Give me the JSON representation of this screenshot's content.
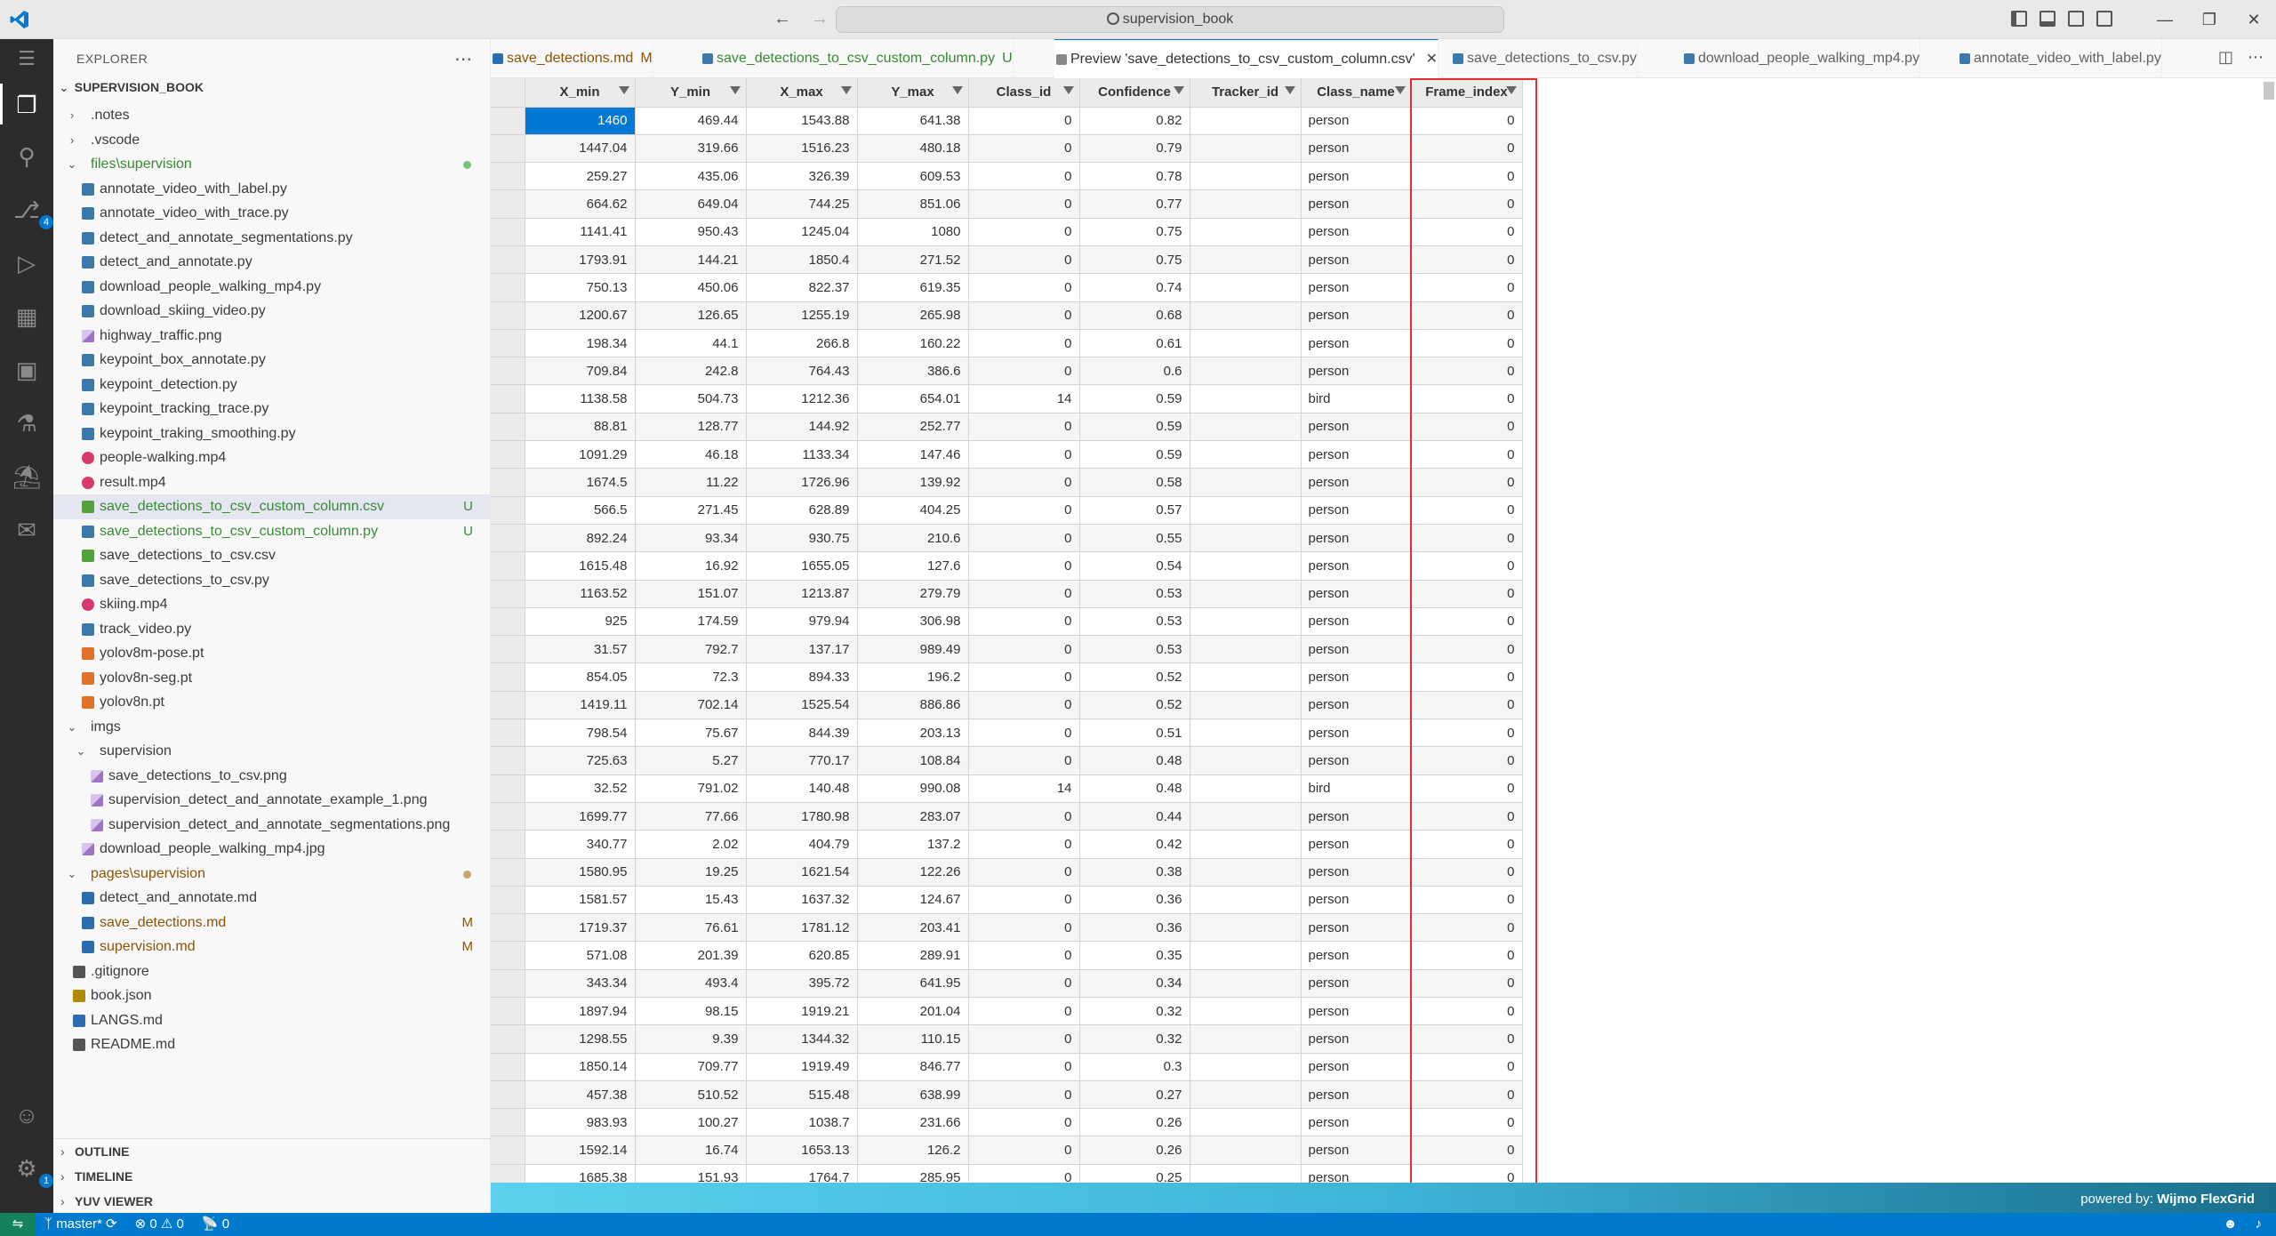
{
  "title": {
    "search_text": "supervision_book"
  },
  "activity": {
    "scm_badge": "4",
    "account_badge": "1"
  },
  "explorer": {
    "title": "EXPLORER",
    "root": "SUPERVISION_BOOK",
    "items": [
      {
        "label": ".notes",
        "kind": "folder",
        "depth": 1,
        "open": false
      },
      {
        "label": ".vscode",
        "kind": "folder",
        "depth": 1,
        "open": false
      },
      {
        "label": "files\\supervision",
        "kind": "folder",
        "depth": 1,
        "open": true,
        "color": "green",
        "dot": "#7bc27b"
      },
      {
        "label": "annotate_video_with_label.py",
        "kind": "py",
        "depth": 2
      },
      {
        "label": "annotate_video_with_trace.py",
        "kind": "py",
        "depth": 2
      },
      {
        "label": "detect_and_annotate_segmentations.py",
        "kind": "py",
        "depth": 2
      },
      {
        "label": "detect_and_annotate.py",
        "kind": "py",
        "depth": 2
      },
      {
        "label": "download_people_walking_mp4.py",
        "kind": "py",
        "depth": 2
      },
      {
        "label": "download_skiing_video.py",
        "kind": "py",
        "depth": 2
      },
      {
        "label": "highway_traffic.png",
        "kind": "img",
        "depth": 2
      },
      {
        "label": "keypoint_box_annotate.py",
        "kind": "py",
        "depth": 2
      },
      {
        "label": "keypoint_detection.py",
        "kind": "py",
        "depth": 2
      },
      {
        "label": "keypoint_tracking_trace.py",
        "kind": "py",
        "depth": 2
      },
      {
        "label": "keypoint_traking_smoothing.py",
        "kind": "py",
        "depth": 2
      },
      {
        "label": "people-walking.mp4",
        "kind": "vid",
        "depth": 2
      },
      {
        "label": "result.mp4",
        "kind": "vid",
        "depth": 2
      },
      {
        "label": "save_detections_to_csv_custom_column.csv",
        "kind": "csv",
        "depth": 2,
        "color": "green",
        "status": "U",
        "selected": true
      },
      {
        "label": "save_detections_to_csv_custom_column.py",
        "kind": "py",
        "depth": 2,
        "color": "green",
        "status": "U"
      },
      {
        "label": "save_detections_to_csv.csv",
        "kind": "csv",
        "depth": 2
      },
      {
        "label": "save_detections_to_csv.py",
        "kind": "py",
        "depth": 2
      },
      {
        "label": "skiing.mp4",
        "kind": "vid",
        "depth": 2
      },
      {
        "label": "track_video.py",
        "kind": "py",
        "depth": 2
      },
      {
        "label": "yolov8m-pose.pt",
        "kind": "rss",
        "depth": 2
      },
      {
        "label": "yolov8n-seg.pt",
        "kind": "rss",
        "depth": 2
      },
      {
        "label": "yolov8n.pt",
        "kind": "rss",
        "depth": 2
      },
      {
        "label": "imgs",
        "kind": "folder",
        "depth": 1,
        "open": true
      },
      {
        "label": "supervision",
        "kind": "folder",
        "depth": 2,
        "open": true
      },
      {
        "label": "save_detections_to_csv.png",
        "kind": "img",
        "depth": 3
      },
      {
        "label": "supervision_detect_and_annotate_example_1.png",
        "kind": "img",
        "depth": 3
      },
      {
        "label": "supervision_detect_and_annotate_segmentations.png",
        "kind": "img",
        "depth": 3
      },
      {
        "label": "download_people_walking_mp4.jpg",
        "kind": "img",
        "depth": 2
      },
      {
        "label": "pages\\supervision",
        "kind": "folder",
        "depth": 1,
        "open": true,
        "color": "olive",
        "dot": "#c9a56a"
      },
      {
        "label": "detect_and_annotate.md",
        "kind": "md",
        "depth": 2
      },
      {
        "label": "save_detections.md",
        "kind": "md",
        "depth": 2,
        "color": "olive",
        "status": "M"
      },
      {
        "label": "supervision.md",
        "kind": "md",
        "depth": 2,
        "color": "olive",
        "status": "M"
      },
      {
        "label": ".gitignore",
        "kind": "git",
        "depth": 1
      },
      {
        "label": "book.json",
        "kind": "json",
        "depth": 1
      },
      {
        "label": "LANGS.md",
        "kind": "md",
        "depth": 1
      },
      {
        "label": "README.md",
        "kind": "info",
        "depth": 1
      }
    ],
    "sections": [
      "OUTLINE",
      "TIMELINE",
      "YUV VIEWER"
    ]
  },
  "tabs": [
    {
      "label": "save_detections.md",
      "status": "M",
      "kind": "md"
    },
    {
      "label": "save_detections_to_csv_custom_column.py",
      "status": "U",
      "kind": "py"
    },
    {
      "label": "Preview 'save_detections_to_csv_custom_column.csv'",
      "status": "",
      "kind": "preview",
      "active": true
    },
    {
      "label": "save_detections_to_csv.py",
      "status": "",
      "kind": "py"
    },
    {
      "label": "download_people_walking_mp4.py",
      "status": "",
      "kind": "py"
    },
    {
      "label": "annotate_video_with_label.py",
      "status": "",
      "kind": "py"
    }
  ],
  "grid": {
    "columns": [
      "X_min",
      "Y_min",
      "X_max",
      "Y_max",
      "Class_id",
      "Confidence",
      "Tracker_id",
      "Class_name",
      "Frame_index"
    ],
    "rows": [
      [
        "1460",
        "469.44",
        "1543.88",
        "641.38",
        "0",
        "0.82",
        "",
        "person",
        "0"
      ],
      [
        "1447.04",
        "319.66",
        "1516.23",
        "480.18",
        "0",
        "0.79",
        "",
        "person",
        "0"
      ],
      [
        "259.27",
        "435.06",
        "326.39",
        "609.53",
        "0",
        "0.78",
        "",
        "person",
        "0"
      ],
      [
        "664.62",
        "649.04",
        "744.25",
        "851.06",
        "0",
        "0.77",
        "",
        "person",
        "0"
      ],
      [
        "1141.41",
        "950.43",
        "1245.04",
        "1080",
        "0",
        "0.75",
        "",
        "person",
        "0"
      ],
      [
        "1793.91",
        "144.21",
        "1850.4",
        "271.52",
        "0",
        "0.75",
        "",
        "person",
        "0"
      ],
      [
        "750.13",
        "450.06",
        "822.37",
        "619.35",
        "0",
        "0.74",
        "",
        "person",
        "0"
      ],
      [
        "1200.67",
        "126.65",
        "1255.19",
        "265.98",
        "0",
        "0.68",
        "",
        "person",
        "0"
      ],
      [
        "198.34",
        "44.1",
        "266.8",
        "160.22",
        "0",
        "0.61",
        "",
        "person",
        "0"
      ],
      [
        "709.84",
        "242.8",
        "764.43",
        "386.6",
        "0",
        "0.6",
        "",
        "person",
        "0"
      ],
      [
        "1138.58",
        "504.73",
        "1212.36",
        "654.01",
        "14",
        "0.59",
        "",
        "bird",
        "0"
      ],
      [
        "88.81",
        "128.77",
        "144.92",
        "252.77",
        "0",
        "0.59",
        "",
        "person",
        "0"
      ],
      [
        "1091.29",
        "46.18",
        "1133.34",
        "147.46",
        "0",
        "0.59",
        "",
        "person",
        "0"
      ],
      [
        "1674.5",
        "11.22",
        "1726.96",
        "139.92",
        "0",
        "0.58",
        "",
        "person",
        "0"
      ],
      [
        "566.5",
        "271.45",
        "628.89",
        "404.25",
        "0",
        "0.57",
        "",
        "person",
        "0"
      ],
      [
        "892.24",
        "93.34",
        "930.75",
        "210.6",
        "0",
        "0.55",
        "",
        "person",
        "0"
      ],
      [
        "1615.48",
        "16.92",
        "1655.05",
        "127.6",
        "0",
        "0.54",
        "",
        "person",
        "0"
      ],
      [
        "1163.52",
        "151.07",
        "1213.87",
        "279.79",
        "0",
        "0.53",
        "",
        "person",
        "0"
      ],
      [
        "925",
        "174.59",
        "979.94",
        "306.98",
        "0",
        "0.53",
        "",
        "person",
        "0"
      ],
      [
        "31.57",
        "792.7",
        "137.17",
        "989.49",
        "0",
        "0.53",
        "",
        "person",
        "0"
      ],
      [
        "854.05",
        "72.3",
        "894.33",
        "196.2",
        "0",
        "0.52",
        "",
        "person",
        "0"
      ],
      [
        "1419.11",
        "702.14",
        "1525.54",
        "886.86",
        "0",
        "0.52",
        "",
        "person",
        "0"
      ],
      [
        "798.54",
        "75.67",
        "844.39",
        "203.13",
        "0",
        "0.51",
        "",
        "person",
        "0"
      ],
      [
        "725.63",
        "5.27",
        "770.17",
        "108.84",
        "0",
        "0.48",
        "",
        "person",
        "0"
      ],
      [
        "32.52",
        "791.02",
        "140.48",
        "990.08",
        "14",
        "0.48",
        "",
        "bird",
        "0"
      ],
      [
        "1699.77",
        "77.66",
        "1780.98",
        "283.07",
        "0",
        "0.44",
        "",
        "person",
        "0"
      ],
      [
        "340.77",
        "2.02",
        "404.79",
        "137.2",
        "0",
        "0.42",
        "",
        "person",
        "0"
      ],
      [
        "1580.95",
        "19.25",
        "1621.54",
        "122.26",
        "0",
        "0.38",
        "",
        "person",
        "0"
      ],
      [
        "1581.57",
        "15.43",
        "1637.32",
        "124.67",
        "0",
        "0.36",
        "",
        "person",
        "0"
      ],
      [
        "1719.37",
        "76.61",
        "1781.12",
        "203.41",
        "0",
        "0.36",
        "",
        "person",
        "0"
      ],
      [
        "571.08",
        "201.39",
        "620.85",
        "289.91",
        "0",
        "0.35",
        "",
        "person",
        "0"
      ],
      [
        "343.34",
        "493.4",
        "395.72",
        "641.95",
        "0",
        "0.34",
        "",
        "person",
        "0"
      ],
      [
        "1897.94",
        "98.15",
        "1919.21",
        "201.04",
        "0",
        "0.32",
        "",
        "person",
        "0"
      ],
      [
        "1298.55",
        "9.39",
        "1344.32",
        "110.15",
        "0",
        "0.32",
        "",
        "person",
        "0"
      ],
      [
        "1850.14",
        "709.77",
        "1919.49",
        "846.77",
        "0",
        "0.3",
        "",
        "person",
        "0"
      ],
      [
        "457.38",
        "510.52",
        "515.48",
        "638.99",
        "0",
        "0.27",
        "",
        "person",
        "0"
      ],
      [
        "983.93",
        "100.27",
        "1038.7",
        "231.66",
        "0",
        "0.26",
        "",
        "person",
        "0"
      ],
      [
        "1592.14",
        "16.74",
        "1653.13",
        "126.2",
        "0",
        "0.26",
        "",
        "person",
        "0"
      ],
      [
        "1685.38",
        "151.93",
        "1764.7",
        "285.95",
        "0",
        "0.25",
        "",
        "person",
        "0"
      ]
    ],
    "powered_by_prefix": "powered by:",
    "powered_by_brand": "Wijmo FlexGrid"
  },
  "status": {
    "branch": "master*",
    "errors": "0",
    "warnings": "0",
    "ports": "0"
  }
}
